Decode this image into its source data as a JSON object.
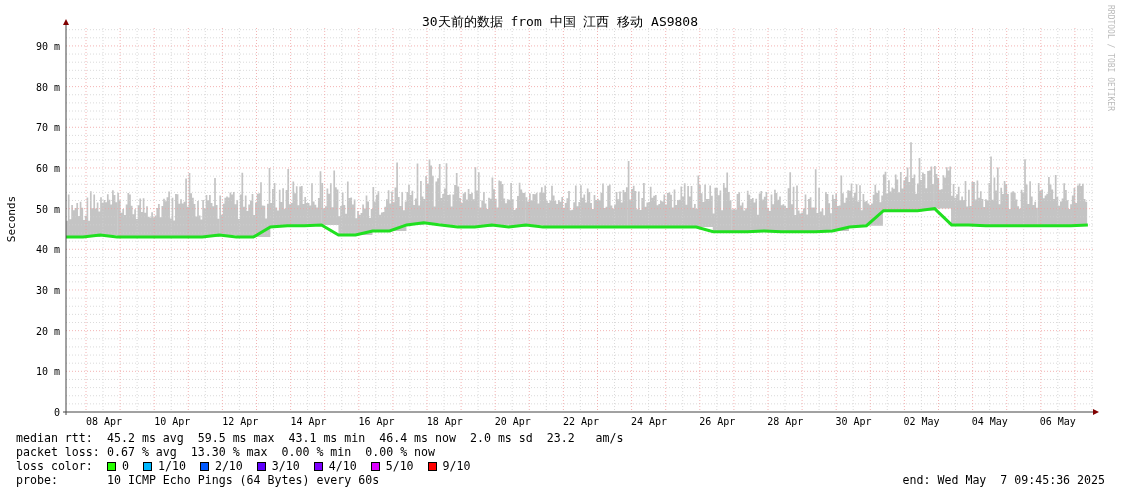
{
  "chart": {
    "chart_data": {
      "type": "line",
      "title": "30天前的数据 from 中国 江西 移动 AS9808",
      "ylabel": "Seconds",
      "categories": [
        null,
        null,
        "08 Apr",
        null,
        null,
        null,
        "10 Apr",
        null,
        null,
        null,
        "12 Apr",
        null,
        null,
        null,
        "14 Apr",
        null,
        null,
        null,
        "16 Apr",
        null,
        null,
        null,
        "18 Apr",
        null,
        null,
        null,
        "20 Apr",
        null,
        null,
        null,
        "22 Apr",
        null,
        null,
        null,
        "24 Apr",
        null,
        null,
        null,
        "26 Apr",
        null,
        null,
        null,
        "28 Apr",
        null,
        null,
        null,
        "30 Apr",
        null,
        null,
        null,
        "02 May",
        null,
        null,
        null,
        "04 May",
        null,
        null,
        null,
        "06 May",
        null,
        null
      ],
      "series": [
        {
          "name": "median rtt:",
          "color": "#20e020",
          "values": [
            43,
            43,
            43.5,
            43,
            43,
            43,
            43,
            43,
            43,
            43.5,
            43,
            43,
            45.5,
            45.8,
            45.8,
            46,
            43.5,
            43.5,
            44.5,
            44.5,
            46,
            46.5,
            46,
            45.5,
            45.5,
            46,
            45.5,
            46,
            45.5,
            45.5,
            45.5,
            45.5,
            45.5,
            45.5,
            45.5,
            45.5,
            45.5,
            45.5,
            44.3,
            44.3,
            44.3,
            44.5,
            44.3,
            44.3,
            44.3,
            44.5,
            45.5,
            45.8,
            49.5,
            49.5,
            49.5,
            50,
            46,
            46,
            45.8,
            45.8,
            45.8,
            45.8,
            45.8,
            45.8,
            46
          ]
        }
      ],
      "ylim": [
        0,
        95
      ],
      "grid": true,
      "yticks": [
        {
          "value": 0,
          "label": "0"
        },
        {
          "value": 10,
          "label": "10 m"
        },
        {
          "value": 20,
          "label": "20 m"
        },
        {
          "value": 30,
          "label": "30 m"
        },
        {
          "value": 40,
          "label": "40 m"
        },
        {
          "value": 50,
          "label": "50 m"
        },
        {
          "value": 60,
          "label": "60 m"
        },
        {
          "value": 70,
          "label": "70 m"
        },
        {
          "value": 80,
          "label": "80 m"
        },
        {
          "value": 90,
          "label": "90 m"
        }
      ]
    },
    "watermark": "RRDTOOL / TOBI OETIKER"
  },
  "legend": {
    "stats": [
      {
        "value": "45.2 ms avg  59.5 ms max  43.1 ms min  46.4 ms now  2.0 ms sd  23.2   am/s"
      },
      {
        "label": "packet loss:",
        "value": "0.67 % avg  13.30 % max  0.00 % min  0.00 % now"
      }
    ],
    "loss_color": {
      "label": "loss color:",
      "items": [
        {
          "label": "0",
          "color": "#26ff00"
        },
        {
          "label": "1/10",
          "color": "#00b8ff"
        },
        {
          "label": "2/10",
          "color": "#0059ff"
        },
        {
          "label": "3/10",
          "color": "#5e00ff"
        },
        {
          "label": "4/10",
          "color": "#7e00ff"
        },
        {
          "label": "5/10",
          "color": "#dd00ff"
        },
        {
          "label": "9/10",
          "color": "#ff0000"
        }
      ]
    },
    "probe": {
      "label": "probe:",
      "value": "10 ICMP Echo Pings (64 Bytes) every 60s"
    },
    "end": "end: Wed May  7 09:45:36 2025"
  }
}
